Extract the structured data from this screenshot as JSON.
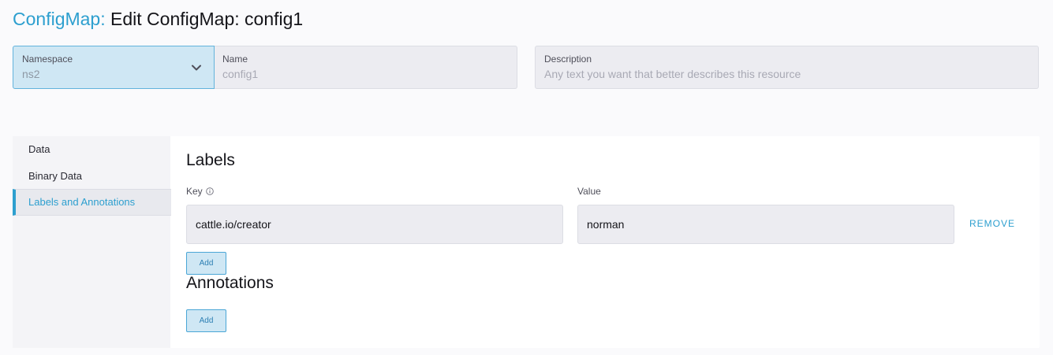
{
  "header": {
    "breadcrumb": "ConfigMap:",
    "title": "Edit ConfigMap: config1"
  },
  "form": {
    "namespace": {
      "label": "Namespace",
      "value": "ns2"
    },
    "name": {
      "label": "Name",
      "value": "config1"
    },
    "description": {
      "label": "Description",
      "placeholder": "Any text you want that better describes this resource"
    }
  },
  "tabs": [
    {
      "label": "Data",
      "active": false
    },
    {
      "label": "Binary Data",
      "active": false
    },
    {
      "label": "Labels and Annotations",
      "active": true
    }
  ],
  "labels": {
    "title": "Labels",
    "key_header": "Key",
    "value_header": "Value",
    "rows": [
      {
        "key": "cattle.io/creator",
        "value": "norman",
        "remove_label": "REMOVE"
      }
    ],
    "add_label": "Add"
  },
  "annotations": {
    "title": "Annotations",
    "add_label": "Add"
  },
  "colors": {
    "accent": "#2d9fcf",
    "active_field_bg": "#cfe7f4",
    "input_bg": "#ececf1"
  }
}
